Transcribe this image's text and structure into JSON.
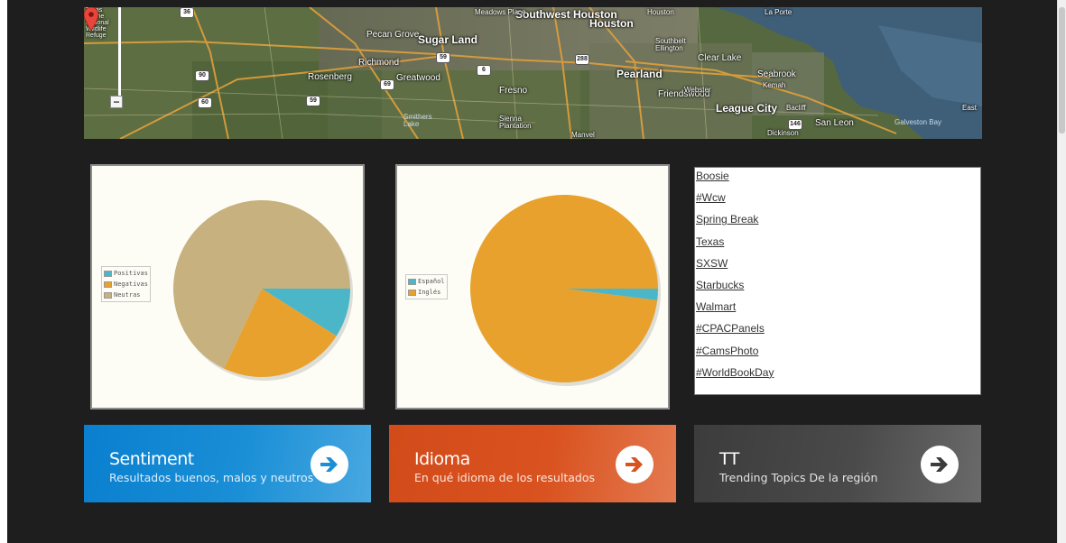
{
  "colors": {
    "page_bg": "#1e1e1e",
    "sentiment_tile": "#1a8fd6",
    "idioma_tile": "#d9521f",
    "tt_tile": "#4a4a4a",
    "positive": "#4bb6c8",
    "negative": "#e9a12e",
    "neutral": "#c7b17e"
  },
  "map": {
    "labels": [
      "Southwest Houston",
      "Houston",
      "Meadows Place",
      "Sugar Land",
      "Pecan Grove",
      "Richmond",
      "Rosenberg",
      "Greatwood",
      "Fresno",
      "Pearland",
      "Friendswood",
      "Southbelt Ellington",
      "Clear Lake",
      "Webster",
      "Seabrook",
      "Kemah",
      "League City",
      "Bacliff",
      "San Leon",
      "Galveston Bay",
      "Dickinson",
      "Manvel",
      "Sienna Plantation",
      "Smithers Lake",
      "Houston",
      "La Porte",
      "Texas Prairie National Wildlife Refuge",
      "East"
    ],
    "road_shields": [
      "36",
      "90",
      "59",
      "6",
      "288",
      "60",
      "69",
      "59",
      "146"
    ],
    "zoom_out_label": "−",
    "pin_icon": "map-marker-icon"
  },
  "charts": [
    {
      "id": "sentiment",
      "chart_data": {
        "type": "pie",
        "labels": [
          "Positivas",
          "Negativas",
          "Neutras"
        ],
        "values": [
          9,
          23,
          68
        ],
        "colors": [
          "#4bb6c8",
          "#e9a12e",
          "#c7b17e"
        ],
        "legend_position": "left"
      }
    },
    {
      "id": "idioma",
      "chart_data": {
        "type": "pie",
        "labels": [
          "Español",
          "Inglés"
        ],
        "values": [
          2,
          98
        ],
        "colors": [
          "#4bb6c8",
          "#e9a12e"
        ],
        "legend_position": "left"
      }
    }
  ],
  "trending_topics": [
    "Boosie",
    "#Wcw",
    "Spring Break",
    "Texas",
    "SXSW",
    "Starbucks",
    "Walmart",
    "#CPACPanels",
    "#CamsPhoto",
    "#WorldBookDay"
  ],
  "tiles": [
    {
      "title": "Sentiment",
      "subtitle": "Resultados buenos, malos y neutros",
      "icon": "arrow-right-circle-icon"
    },
    {
      "title": "Idioma",
      "subtitle": "En qué idioma de los resultados",
      "icon": "arrow-right-circle-icon"
    },
    {
      "title": "TT",
      "subtitle": "Trending Topics De la región",
      "icon": "arrow-right-circle-icon"
    }
  ]
}
